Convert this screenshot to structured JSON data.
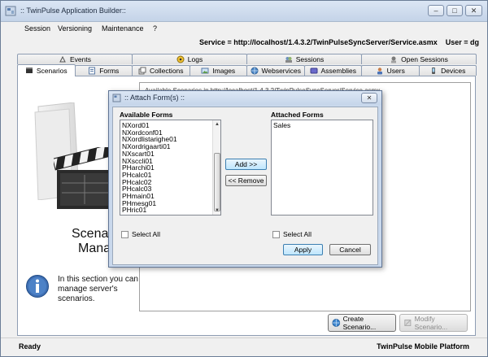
{
  "window": {
    "title": ":: TwinPulse Application Builder::",
    "controls": [
      "minimize-icon",
      "maximize-icon",
      "close-icon"
    ]
  },
  "menu": {
    "items": [
      "Session",
      "Versioning",
      "Maintenance",
      "?"
    ]
  },
  "service": {
    "text": "Service = http://localhost/1.4.3.2/TwinPulseSyncServer/Service.asmx    User = dg"
  },
  "tabs": {
    "row1": [
      {
        "label": "Events",
        "icon": "events-icon"
      },
      {
        "label": "Logs",
        "icon": "logs-icon"
      },
      {
        "label": "Sessions",
        "icon": "sessions-icon"
      },
      {
        "label": "Open Sessions",
        "icon": "open-sessions-icon"
      }
    ],
    "row2": [
      {
        "label": "Scenarios",
        "icon": "scenarios-icon"
      },
      {
        "label": "Forms",
        "icon": "forms-icon"
      },
      {
        "label": "Collections",
        "icon": "collections-icon"
      },
      {
        "label": "Images",
        "icon": "images-icon"
      },
      {
        "label": "Webservices",
        "icon": "webservices-icon"
      },
      {
        "label": "Assemblies",
        "icon": "assemblies-icon"
      },
      {
        "label": "Users",
        "icon": "users-icon"
      },
      {
        "label": "Devices",
        "icon": "devices-icon"
      }
    ],
    "active": "Scenarios"
  },
  "panel": {
    "heading_line1": "Scena",
    "heading_line2": "Mana",
    "info_text": "In this section you can manage server's scenarios.",
    "list_item": "Available Scenarios in http://localhost/1.4.3.2/TwinPulseSyncServer/Service.asmx",
    "create_button": "Create Scenario...",
    "modify_button": "Modify Scenario..."
  },
  "dialog": {
    "title": ":: Attach Form(s) ::",
    "available_label": "Available Forms",
    "attached_label": "Attached Forms",
    "available_items": [
      "NXord01",
      "NXordconf01",
      "NXordlistarighe01",
      "NXordrigaarti01",
      "NXscart01",
      "NXsccli01",
      "PHarchi01",
      "PHcalc01",
      "PHcalc02",
      "PHcalc03",
      "PHmain01",
      "PHmesg01",
      "PHric01"
    ],
    "attached_items": [
      "Sales"
    ],
    "add_button": "Add >>",
    "remove_button": "<< Remove",
    "select_all_left": "Select All",
    "select_all_right": "Select All",
    "apply_button": "Apply",
    "cancel_button": "Cancel"
  },
  "status": {
    "left": "Ready",
    "right": "TwinPulse Mobile Platform"
  }
}
